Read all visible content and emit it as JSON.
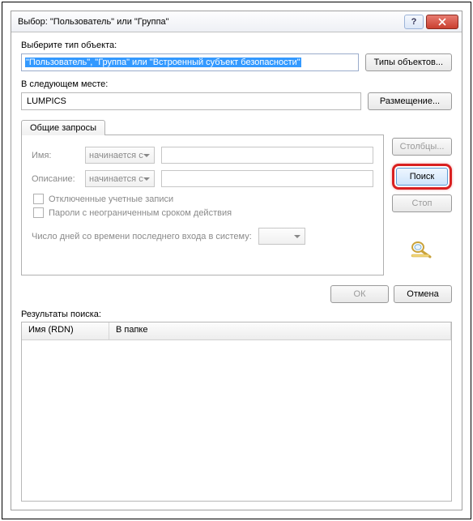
{
  "title": "Выбор: \"Пользователь\" или \"Группа\"",
  "labels": {
    "object_type": "Выберите тип объекта:",
    "location": "В следующем месте:",
    "results": "Результаты поиска:"
  },
  "fields": {
    "object_type_value": "\"Пользователь\", \"Группа\" или \"Встроенный субъект безопасности\"",
    "location_value": "LUMPICS"
  },
  "buttons": {
    "object_types": "Типы объектов...",
    "placement": "Размещение...",
    "columns": "Столбцы...",
    "search": "Поиск",
    "stop": "Стоп",
    "ok": "ОК",
    "cancel": "Отмена"
  },
  "tab": {
    "label": "Общие запросы",
    "name_label": "Имя:",
    "desc_label": "Описание:",
    "dd_option": "начинается с",
    "chk_disabled": "Отключенные учетные записи",
    "chk_password": "Пароли с неограниченным сроком действия",
    "days_label": "Число дней со времени последнего входа в систему:"
  },
  "table": {
    "col1": "Имя (RDN)",
    "col2": "В папке"
  }
}
